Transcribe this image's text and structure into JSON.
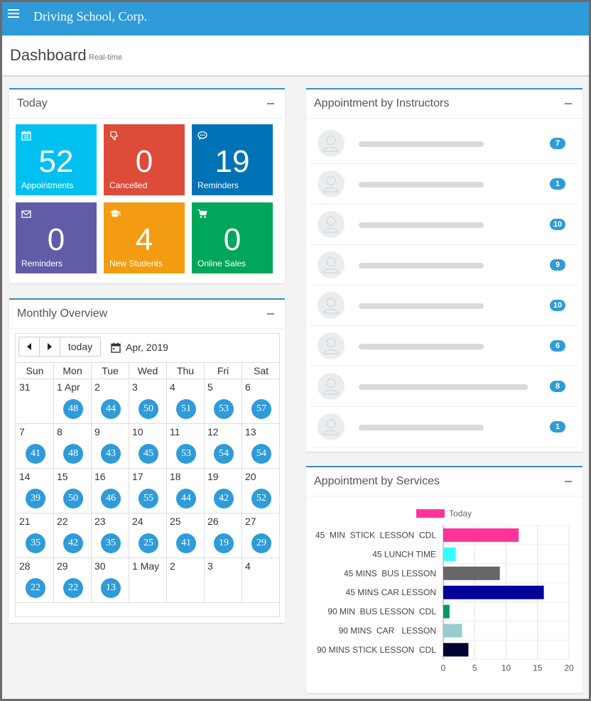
{
  "app": {
    "brand": "Driving School, Corp."
  },
  "page": {
    "title": "Dashboard",
    "subtitle": "Real-time"
  },
  "today": {
    "title": "Today",
    "tiles": [
      {
        "value": "52",
        "label": "Appointments",
        "icon": "calendar-icon",
        "color": "#00c0ef"
      },
      {
        "value": "0",
        "label": "Cancelled",
        "icon": "thumbs-down-icon",
        "color": "#dd4b39"
      },
      {
        "value": "19",
        "label": "Reminders",
        "icon": "chat-bubble-icon",
        "color": "#0073b7"
      },
      {
        "value": "0",
        "label": "Reminders",
        "icon": "envelope-icon",
        "color": "#605ca8"
      },
      {
        "value": "4",
        "label": "New Students",
        "icon": "graduation-cap-icon",
        "color": "#f39c12"
      },
      {
        "value": "0",
        "label": "Online Sales",
        "icon": "shopping-cart-icon",
        "color": "#00a65a"
      }
    ]
  },
  "monthly": {
    "title": "Monthly Overview",
    "today_label": "today",
    "month_label": "Apr, 2019",
    "weekdays": [
      "Sun",
      "Mon",
      "Tue",
      "Wed",
      "Thu",
      "Fri",
      "Sat"
    ],
    "weeks": [
      [
        {
          "d": "31",
          "n": ""
        },
        {
          "d": "1 Apr",
          "n": "48"
        },
        {
          "d": "2",
          "n": "44"
        },
        {
          "d": "3",
          "n": "50"
        },
        {
          "d": "4",
          "n": "51"
        },
        {
          "d": "5",
          "n": "53"
        },
        {
          "d": "6",
          "n": "57"
        }
      ],
      [
        {
          "d": "7",
          "n": "41"
        },
        {
          "d": "8",
          "n": "48"
        },
        {
          "d": "9",
          "n": "43"
        },
        {
          "d": "10",
          "n": "45"
        },
        {
          "d": "11",
          "n": "53"
        },
        {
          "d": "12",
          "n": "54"
        },
        {
          "d": "13",
          "n": "54"
        }
      ],
      [
        {
          "d": "14",
          "n": "39"
        },
        {
          "d": "15",
          "n": "50"
        },
        {
          "d": "16",
          "n": "46"
        },
        {
          "d": "17",
          "n": "55"
        },
        {
          "d": "18",
          "n": "44"
        },
        {
          "d": "19",
          "n": "42"
        },
        {
          "d": "20",
          "n": "52"
        }
      ],
      [
        {
          "d": "21",
          "n": "35"
        },
        {
          "d": "22",
          "n": "42"
        },
        {
          "d": "23",
          "n": "35"
        },
        {
          "d": "24",
          "n": "25"
        },
        {
          "d": "25",
          "n": "41"
        },
        {
          "d": "26",
          "n": "19"
        },
        {
          "d": "27",
          "n": "29"
        }
      ],
      [
        {
          "d": "28",
          "n": "22"
        },
        {
          "d": "29",
          "n": "22"
        },
        {
          "d": "30",
          "n": "13"
        },
        {
          "d": "1 May",
          "n": ""
        },
        {
          "d": "2",
          "n": ""
        },
        {
          "d": "3",
          "n": ""
        },
        {
          "d": "4",
          "n": ""
        }
      ]
    ]
  },
  "instructors": {
    "title": "Appointment by Instructors",
    "rows": [
      {
        "count": "7"
      },
      {
        "count": "1"
      },
      {
        "count": "10"
      },
      {
        "count": "9"
      },
      {
        "count": "10"
      },
      {
        "count": "6"
      },
      {
        "count": "8",
        "wide": true
      },
      {
        "count": "1"
      }
    ]
  },
  "services": {
    "title": "Appointment by Services",
    "chart_data": {
      "type": "bar",
      "orientation": "horizontal",
      "categories": [
        "45  MIN  STICK  LESSON  CDL",
        "45 LUNCH TIME",
        "45 MINS  BUS LESSON",
        "45 MINS CAR LESSON",
        "90 MIN  BUS LESSON  CDL",
        "90 MINS  CAR   LESSON",
        "90 MINS STICK LESSON  CDL"
      ],
      "series": [
        {
          "name": "Today",
          "values": [
            12,
            2,
            9,
            16,
            1,
            3,
            4
          ]
        }
      ],
      "bar_colors": [
        "#ff3399",
        "#33ffff",
        "#666666",
        "#000099",
        "#009966",
        "#99cccc",
        "#000033"
      ],
      "legend_color": "#ff3399",
      "xlim": [
        0,
        20
      ],
      "xticks": [
        0,
        5,
        10,
        15,
        20
      ],
      "grid": true,
      "legend": "top"
    }
  }
}
